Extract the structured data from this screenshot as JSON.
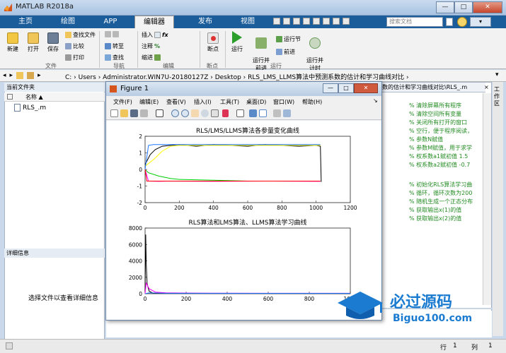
{
  "window": {
    "title": "MATLAB R2018a",
    "controls": [
      "—",
      "□",
      "✕"
    ]
  },
  "tabs": [
    {
      "label": "主页",
      "active": false
    },
    {
      "label": "绘图",
      "active": false
    },
    {
      "label": "APP",
      "active": false
    },
    {
      "label": "编辑器",
      "active": true
    },
    {
      "label": "发布",
      "active": false
    },
    {
      "label": "视图",
      "active": false
    }
  ],
  "search": {
    "placeholder": "搜索文档"
  },
  "ribbon": {
    "new": "新建",
    "open": "打开",
    "save": "保存",
    "find_files": "查找文件",
    "compare": "比较",
    "print": "打印",
    "goto": "转至",
    "find": "查找",
    "insert": "插入",
    "comment": "注释",
    "indent": "缩进",
    "breakpoints": "断点",
    "run": "运行",
    "run_advance": "运行并\n前进",
    "run_section": "运行节",
    "advance": "前进",
    "run_time": "运行并\n计时",
    "groups": {
      "file": "文件",
      "nav": "导航",
      "edit": "编辑",
      "breakpoints": "断点",
      "run": "运行"
    }
  },
  "address": {
    "path": "C: › Users › Administrator.WIN7U-20180127Z › Desktop › RLS_LMS_LLMS算法中预测系数的估计和学习曲线对比 ›"
  },
  "current_folder": {
    "title": "当前文件夹",
    "col_name": "名称 ▲",
    "files": [
      "RLS_.m"
    ]
  },
  "details": {
    "title": "详细信息",
    "message": "选择文件以查看详细信息"
  },
  "editor": {
    "tab_title": "数的估计和学习曲线对比\\RLS_.m",
    "comments": [
      "% 清除屏幕所有程序",
      "% 清除空间所有变量",
      "% 关闭所有打开的窗口",
      "% 空行，便于程序阅读，",
      "% 参数N赋值",
      "% 参数M赋值，用于求学",
      "% 权系数a1赋初值 1.5",
      "% 权系数a2赋初值 -0.7",
      "% 初始化RLS算法学习曲",
      "% 循环，循环次数为200",
      "% 随机生成一个正态分布",
      "% 获取输出x(1)的值",
      "% 获取输出x(2)的值"
    ]
  },
  "right_strip": {
    "label": "工作区"
  },
  "status": {
    "row_label": "行",
    "row": "1",
    "col_label": "列",
    "col": "1"
  },
  "figure": {
    "title": "Figure 1",
    "menu": [
      "文件(F)",
      "编辑(E)",
      "查看(V)",
      "插入(I)",
      "工具(T)",
      "桌面(D)",
      "窗口(W)",
      "帮助(H)"
    ],
    "controls": [
      "—",
      "□",
      "✕"
    ]
  },
  "chart_data": [
    {
      "type": "line",
      "title": "RLS/LMS/LLMS算法各参量变化曲线",
      "xlabel": "",
      "ylabel": "",
      "xlim": [
        0,
        1200
      ],
      "ylim": [
        -2,
        2
      ],
      "xticks": [
        0,
        200,
        400,
        600,
        800,
        1000,
        1200
      ],
      "yticks": [
        -2,
        -1,
        0,
        1,
        2
      ],
      "series": [
        {
          "color": "#000000",
          "x": [
            0,
            30,
            60,
            100,
            150,
            200,
            300,
            400,
            500,
            600,
            700,
            800,
            900,
            1000,
            1025,
            1030
          ],
          "y": [
            0.3,
            0.9,
            1.2,
            1.4,
            1.45,
            1.5,
            1.4,
            1.5,
            1.45,
            1.4,
            1.5,
            1.45,
            1.4,
            1.45,
            1.4,
            -0.75
          ]
        },
        {
          "color": "#ffff00",
          "x": [
            0,
            50,
            100,
            150,
            200,
            400,
            600,
            800,
            1000,
            1025
          ],
          "y": [
            0.2,
            0.6,
            1.1,
            1.4,
            1.45,
            1.45,
            1.45,
            1.45,
            1.45,
            1.45
          ]
        },
        {
          "color": "#1f77ff",
          "x": [
            0,
            20,
            50,
            100,
            400,
            700,
            1000,
            1025
          ],
          "y": [
            0,
            1.45,
            1.5,
            1.5,
            1.5,
            1.5,
            1.5,
            1.5
          ]
        },
        {
          "color": "#00cc00",
          "x": [
            0,
            20,
            80,
            150,
            200,
            400,
            600,
            800,
            1000,
            1025
          ],
          "y": [
            0,
            -0.2,
            -0.4,
            -0.55,
            -0.6,
            -0.65,
            -0.7,
            -0.7,
            -0.7,
            -0.7
          ]
        },
        {
          "color": "#ff00ff",
          "x": [
            0,
            20,
            80,
            150,
            400,
            700,
            1000,
            1025
          ],
          "y": [
            0,
            -0.7,
            -0.72,
            -0.7,
            -0.72,
            -0.7,
            -0.72,
            -0.72
          ]
        },
        {
          "color": "#ff0000",
          "x": [
            0,
            10,
            100,
            400,
            700,
            1000,
            1025
          ],
          "y": [
            0,
            -0.7,
            -0.7,
            -0.7,
            -0.7,
            -0.7,
            -0.7
          ]
        }
      ]
    },
    {
      "type": "line",
      "title": "RLS算法和LMS算法、LLMS算法学习曲线",
      "xlabel": "",
      "ylabel": "",
      "xlim": [
        0,
        1000
      ],
      "ylim": [
        0,
        8000
      ],
      "xticks": [
        0,
        200,
        400,
        600,
        800,
        1000
      ],
      "yticks": [
        0,
        2000,
        4000,
        6000,
        8000
      ],
      "series": [
        {
          "color": "#000000",
          "x": [
            0,
            3,
            6,
            10,
            20,
            40,
            1000
          ],
          "y": [
            0,
            7200,
            3500,
            1200,
            300,
            50,
            30
          ]
        },
        {
          "color": "#ff00ff",
          "x": [
            0,
            5,
            20,
            50,
            100,
            300,
            1000
          ],
          "y": [
            0,
            1300,
            600,
            200,
            100,
            60,
            50
          ]
        },
        {
          "color": "#1f77ff",
          "x": [
            0,
            20,
            100,
            1000
          ],
          "y": [
            0,
            100,
            50,
            40
          ]
        }
      ]
    }
  ]
}
